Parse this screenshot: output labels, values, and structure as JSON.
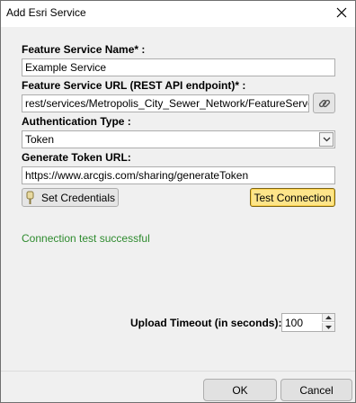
{
  "window": {
    "title": "Add Esri Service"
  },
  "form": {
    "feature_service_name_label": "Feature Service Name* :",
    "feature_service_name_value": "Example Service",
    "feature_service_url_label": "Feature Service URL (REST API endpoint)* :",
    "feature_service_url_value": "rest/services/Metropolis_City_Sewer_Network/FeatureServer",
    "authentication_type_label": "Authentication Type :",
    "authentication_type_value": "Token",
    "generate_token_url_label": "Generate Token URL:",
    "generate_token_url_value": "https://www.arcgis.com/sharing/generateToken",
    "set_credentials_label": "Set Credentials",
    "test_connection_label": "Test Connection",
    "status_message": "Connection test successful",
    "upload_timeout_label": "Upload Timeout (in seconds):",
    "upload_timeout_value": "100"
  },
  "footer": {
    "ok_label": "OK",
    "cancel_label": "Cancel"
  },
  "icons": {
    "close": "close-icon",
    "link": "link-icon",
    "key": "key-icon",
    "dropdown": "chevron-down-icon",
    "spin_up": "spin-up-icon",
    "spin_down": "spin-down-icon"
  },
  "colors": {
    "status_success": "#2e8b2e",
    "test_button": "#fde58a"
  }
}
